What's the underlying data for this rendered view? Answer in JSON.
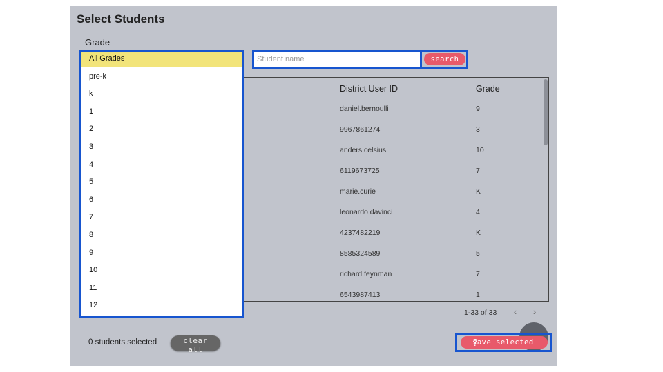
{
  "page": {
    "title": "Select Students"
  },
  "filters": {
    "grade_label": "Grade",
    "grade_options": [
      "All Grades",
      "pre-k",
      "k",
      "1",
      "2",
      "3",
      "4",
      "5",
      "6",
      "7",
      "8",
      "9",
      "10",
      "11",
      "12"
    ],
    "selected_grade": "All Grades",
    "search_placeholder": "Student name",
    "search_label": "search"
  },
  "table": {
    "columns": [
      "District User ID",
      "Grade"
    ],
    "rows": [
      [
        "daniel.bernoulli",
        "9"
      ],
      [
        "9967861274",
        "3"
      ],
      [
        "anders.celsius",
        "10"
      ],
      [
        "6119673725",
        "7"
      ],
      [
        "marie.curie",
        "K"
      ],
      [
        "leonardo.davinci",
        "4"
      ],
      [
        "4237482219",
        "K"
      ],
      [
        "8585324589",
        "5"
      ],
      [
        "richard.feynman",
        "7"
      ],
      [
        "6543987413",
        "1"
      ]
    ]
  },
  "pagination": {
    "range": "1-33 of 33",
    "prev_icon": "‹",
    "next_icon": "›"
  },
  "footer": {
    "selected_text": "0 students selected",
    "clear_label": "clear all",
    "save_label": "save selected",
    "help_label": "?"
  }
}
